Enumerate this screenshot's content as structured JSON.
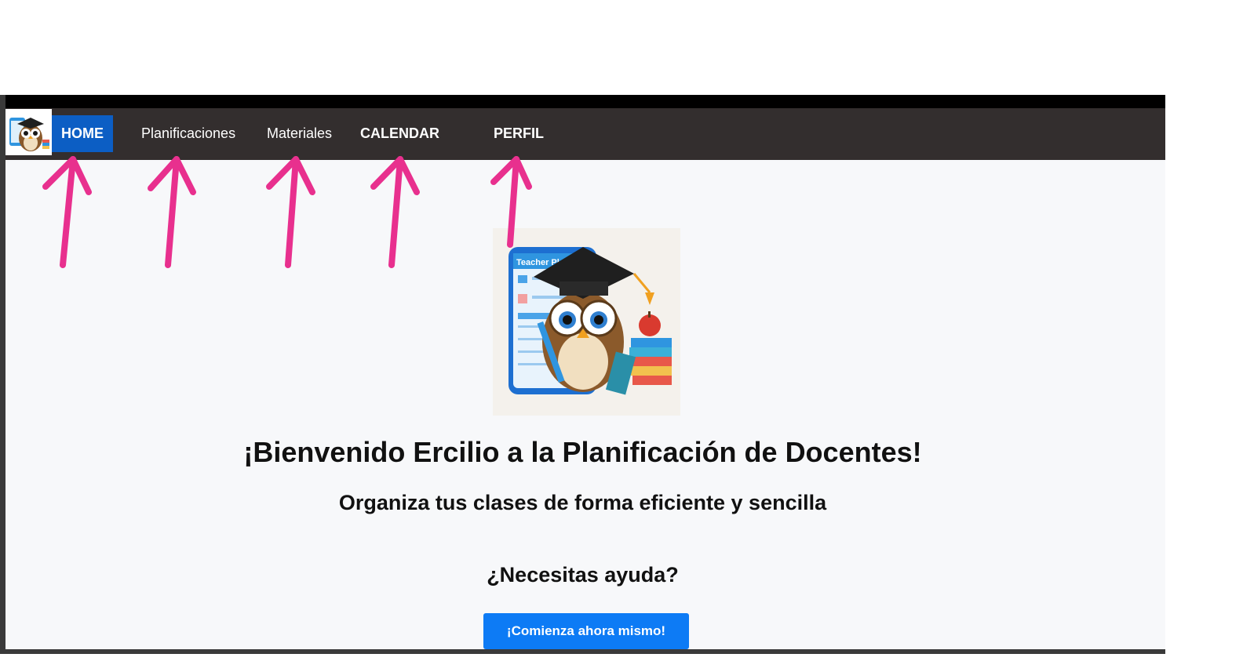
{
  "navbar": {
    "logo_name": "owl-logo-icon",
    "items": [
      {
        "label": "HOME",
        "active": true
      },
      {
        "label": "Planificaciones",
        "active": false
      },
      {
        "label": "Materiales",
        "active": false
      },
      {
        "label": "CALENDAR",
        "active": false
      },
      {
        "label": "PERFIL",
        "active": false
      }
    ]
  },
  "hero": {
    "image_name": "owl-teacher-illustration",
    "image_phone_text": "Teacher Pl",
    "title": "¡Bienvenido Ercilio a la Planificación de Docentes!",
    "subtitle": "Organiza tus clases de forma eficiente y sencilla",
    "help_heading": "¿Necesitas ayuda?",
    "cta_label": "¡Comienza ahora mismo!"
  },
  "annotations": {
    "arrow_color": "#e8308e",
    "arrow_count": 5
  },
  "colors": {
    "navbar_bg": "#332e2e",
    "active_bg": "#0c5ec4",
    "cta_bg": "#0d7bf5",
    "page_bg": "#f7f8fa"
  }
}
